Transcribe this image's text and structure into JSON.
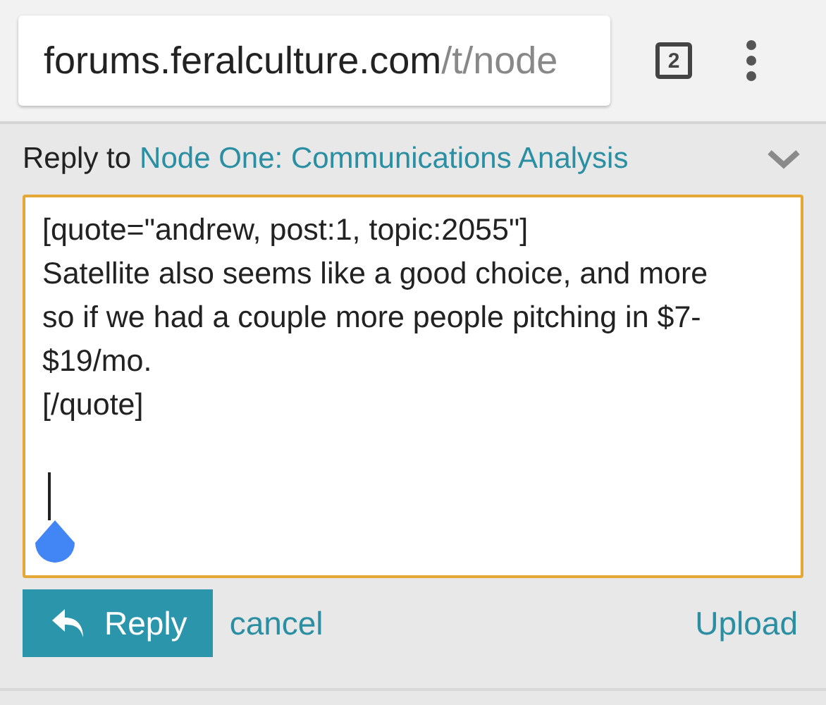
{
  "browser": {
    "url_host": "forums.feralculture.com",
    "url_path": "/t/node",
    "tab_count": "2"
  },
  "composer": {
    "reply_prefix": "Reply to",
    "topic_title": "Node One: Communications Analysis",
    "editor_lines": [
      "[quote=\"andrew, post:1, topic:2055\"]",
      "Satellite also seems like a good choice, and more",
      "so if we had a couple more people pitching in $7-",
      "$19/mo.",
      "[/quote]"
    ],
    "reply_button": "Reply",
    "cancel_link": "cancel",
    "upload_link": "Upload"
  }
}
